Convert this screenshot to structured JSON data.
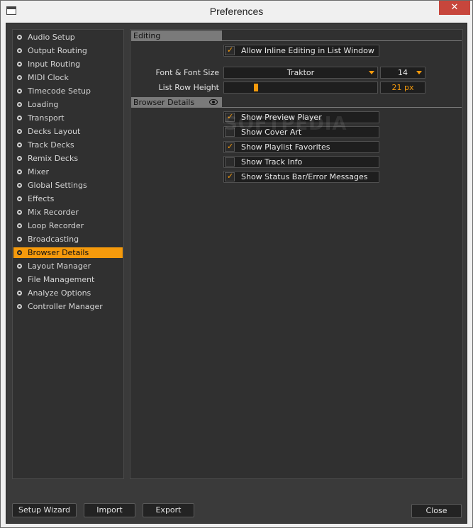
{
  "window": {
    "title": "Preferences",
    "close_glyph": "✕"
  },
  "sidebar": {
    "items": [
      {
        "label": "Audio Setup",
        "active": false
      },
      {
        "label": "Output Routing",
        "active": false
      },
      {
        "label": "Input Routing",
        "active": false
      },
      {
        "label": "MIDI Clock",
        "active": false
      },
      {
        "label": "Timecode Setup",
        "active": false
      },
      {
        "label": "Loading",
        "active": false
      },
      {
        "label": "Transport",
        "active": false
      },
      {
        "label": "Decks Layout",
        "active": false
      },
      {
        "label": "Track Decks",
        "active": false
      },
      {
        "label": "Remix Decks",
        "active": false
      },
      {
        "label": "Mixer",
        "active": false
      },
      {
        "label": "Global Settings",
        "active": false
      },
      {
        "label": "Effects",
        "active": false
      },
      {
        "label": "Mix Recorder",
        "active": false
      },
      {
        "label": "Loop Recorder",
        "active": false
      },
      {
        "label": "Broadcasting",
        "active": false
      },
      {
        "label": "Browser Details",
        "active": true
      },
      {
        "label": "Layout Manager",
        "active": false
      },
      {
        "label": "File Management",
        "active": false
      },
      {
        "label": "Analyze Options",
        "active": false
      },
      {
        "label": "Controller Manager",
        "active": false
      }
    ]
  },
  "editing": {
    "header": "Editing",
    "allow_inline": {
      "label": "Allow Inline Editing in List Window",
      "checked": true
    },
    "font_label": "Font & Font Size",
    "font_value": "Traktor",
    "font_size_value": "14",
    "row_height_label": "List Row Height",
    "row_height_value": "21 px",
    "row_height_fraction": 0.2
  },
  "browser_details": {
    "header": "Browser Details",
    "options": [
      {
        "label": "Show Preview Player",
        "checked": true
      },
      {
        "label": "Show Cover Art",
        "checked": false
      },
      {
        "label": "Show Playlist Favorites",
        "checked": true
      },
      {
        "label": "Show Track Info",
        "checked": false
      },
      {
        "label": "Show Status Bar/Error Messages",
        "checked": true
      }
    ]
  },
  "watermark": "SOFTPEDIA",
  "footer": {
    "setup_wizard": "Setup Wizard",
    "import": "Import",
    "export": "Export",
    "close": "Close"
  },
  "colors": {
    "accent": "#f59a0c",
    "panel": "#303030",
    "background": "#3a3a3a"
  }
}
